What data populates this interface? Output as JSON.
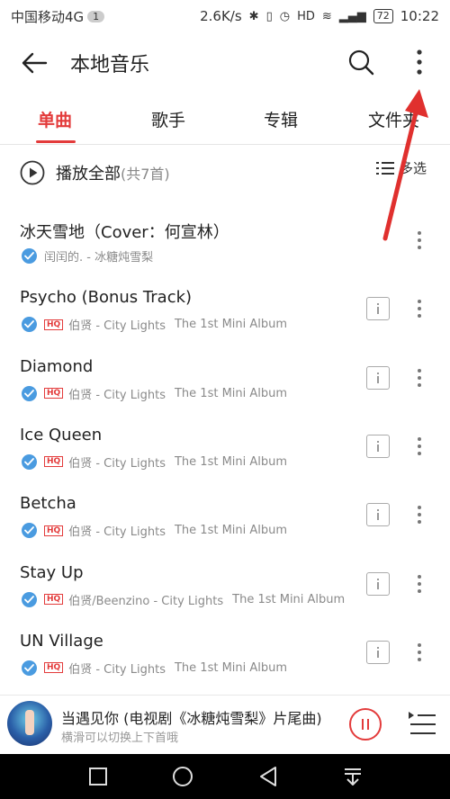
{
  "status": {
    "carrier": "中国移动4G",
    "badge": "1",
    "speed": "2.6K/s",
    "battery": "72",
    "time": "10:22"
  },
  "appbar": {
    "title": "本地音乐"
  },
  "tabs": [
    "单曲",
    "歌手",
    "专辑",
    "文件夹"
  ],
  "play_all": {
    "label": "播放全部",
    "count": "(共7首)",
    "multiselect": "多选"
  },
  "songs": [
    {
      "title": "冰天雪地（Cover：何宣林）",
      "artist": "闰闰的. - 冰糖炖雪梨",
      "album": "",
      "hq": false,
      "info": false
    },
    {
      "title": "Psycho (Bonus Track)",
      "artist": "伯贤 - City Lights",
      "album": "The 1st Mini Album",
      "hq": true,
      "info": true
    },
    {
      "title": "Diamond",
      "artist": "伯贤 - City Lights",
      "album": "The 1st Mini Album",
      "hq": true,
      "info": true
    },
    {
      "title": "Ice Queen",
      "artist": "伯贤 - City Lights",
      "album": "The 1st Mini Album",
      "hq": true,
      "info": true
    },
    {
      "title": "Betcha",
      "artist": "伯贤 - City Lights",
      "album": "The 1st Mini Album",
      "hq": true,
      "info": true
    },
    {
      "title": "Stay Up",
      "artist": "伯贤/Beenzino - City Lights",
      "album": "The 1st Mini Album",
      "hq": true,
      "info": true
    },
    {
      "title": "UN Village",
      "artist": "伯贤 - City Lights",
      "album": "The 1st Mini Album",
      "hq": true,
      "info": true
    }
  ],
  "hq_label": "HQ",
  "now_playing": {
    "title": "当遇见你 (电视剧《冰糖炖雪梨》片尾曲)",
    "hint": "横滑可以切换上下首哦"
  },
  "colors": {
    "accent": "#e33b3b",
    "check": "#4a9be0"
  }
}
